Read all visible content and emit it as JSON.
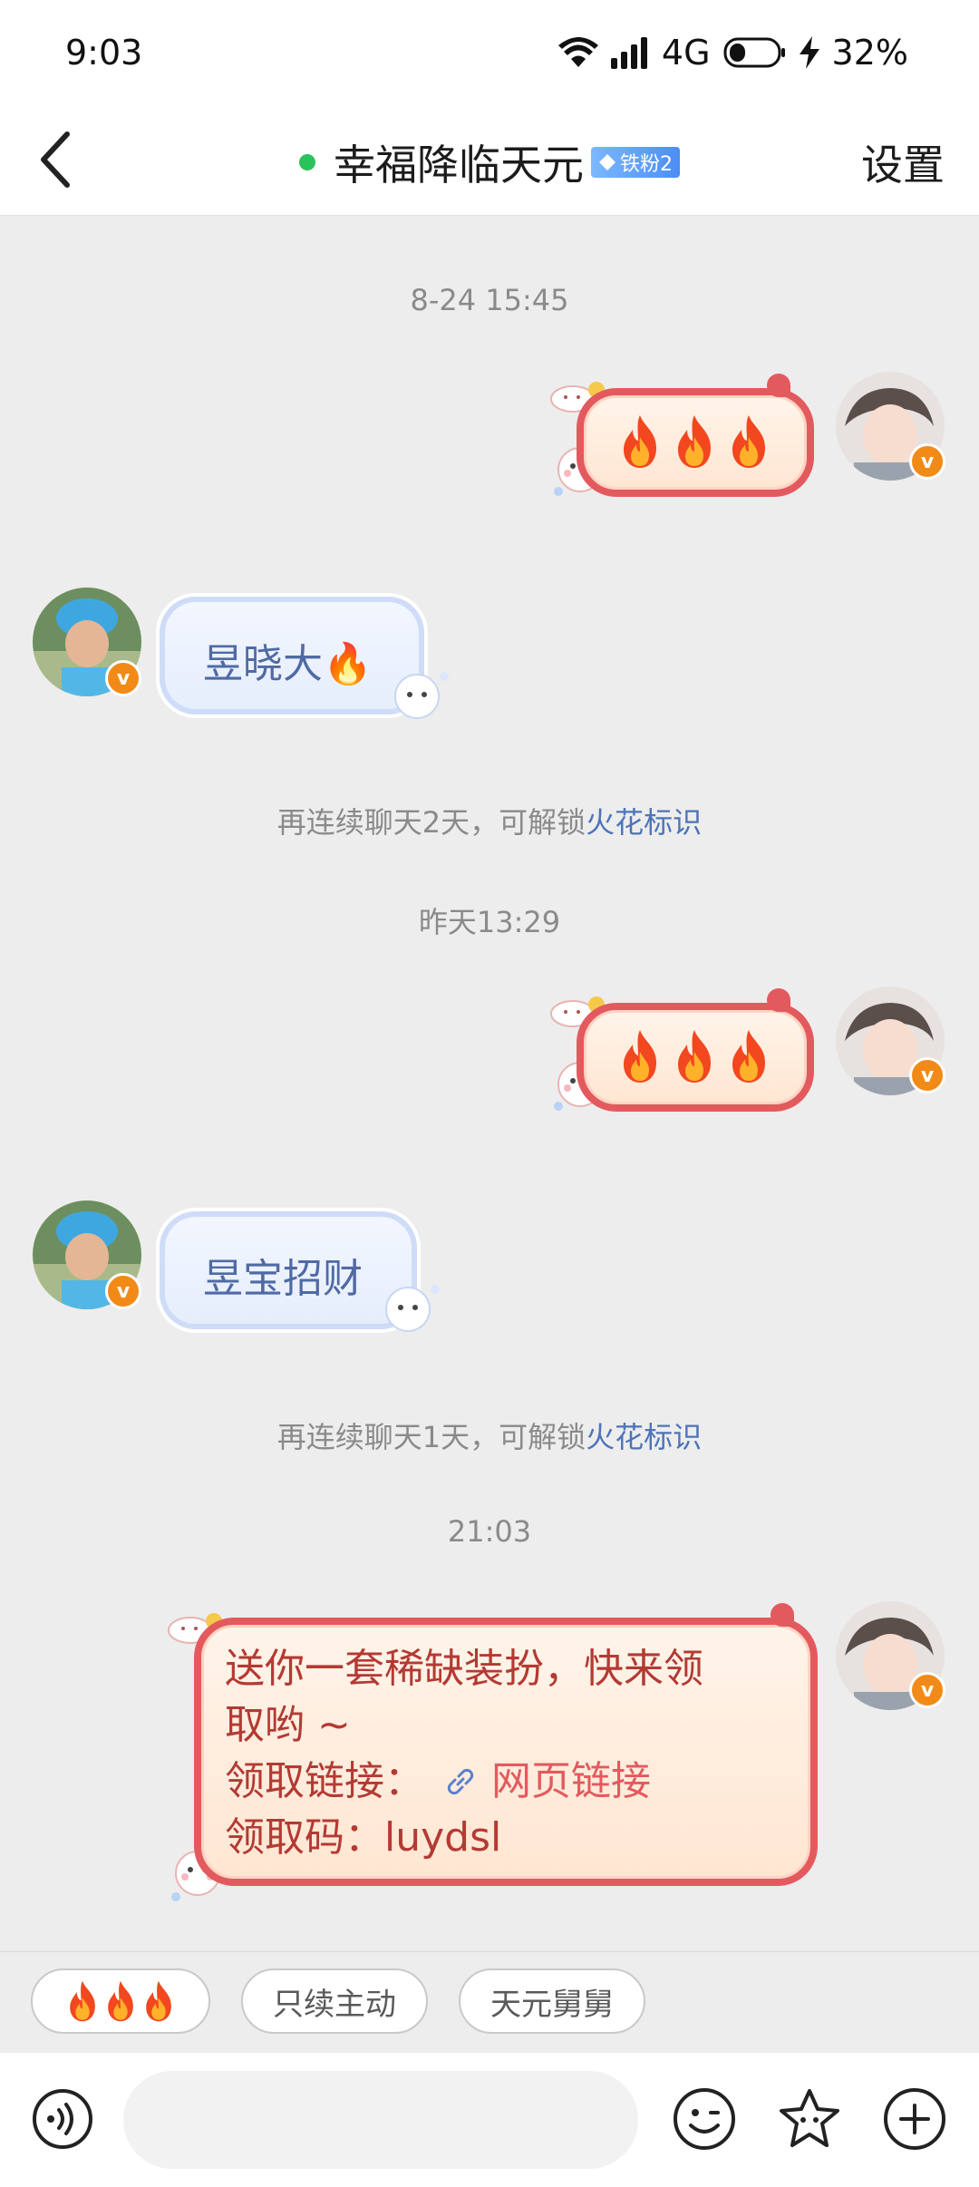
{
  "status_bar": {
    "time": "9:03",
    "network": "4G",
    "battery": "32%",
    "icons": [
      "wifi-icon",
      "signal-icon",
      "battery-icon",
      "charging-icon"
    ]
  },
  "header": {
    "back_icon": "chevron-left-icon",
    "title": "幸福降临天元",
    "badge": "铁粉2",
    "settings": "设置",
    "online_color": "#2bc25b"
  },
  "messages": [
    {
      "type": "timestamp",
      "text": "8-24 15:45"
    },
    {
      "type": "sent",
      "content": "🔥🔥🔥"
    },
    {
      "type": "received",
      "text": "昱晓大🔥"
    },
    {
      "type": "system",
      "text": "再连续聊天2天，可解锁",
      "highlight": "火花标识"
    },
    {
      "type": "timestamp",
      "text": "昨天13:29"
    },
    {
      "type": "sent",
      "content": "🔥🔥🔥"
    },
    {
      "type": "received",
      "text": "昱宝招财"
    },
    {
      "type": "system",
      "text": "再连续聊天1天，可解锁",
      "highlight": "火花标识"
    },
    {
      "type": "timestamp",
      "text": "21:03"
    },
    {
      "type": "sent",
      "line1": "送你一套稀缺装扮，快来领",
      "line2": "取哟 ~",
      "line3_label": "领取链接：",
      "line3_link": "网页链接",
      "line4": "领取码：luydsl"
    }
  ],
  "avatar_badge": "v",
  "quick_replies": [
    {
      "label": "🔥🔥🔥"
    },
    {
      "label": "只续主动"
    },
    {
      "label": "天元舅舅"
    }
  ],
  "input": {
    "placeholder": "",
    "icons": [
      "voice-icon",
      "emoji-icon",
      "sticker-icon",
      "add-icon"
    ]
  },
  "colors": {
    "bubble_border": "#e35a5e",
    "link": "#e35a5e",
    "system_link": "#4d74b8",
    "badge": "#f28a17"
  }
}
